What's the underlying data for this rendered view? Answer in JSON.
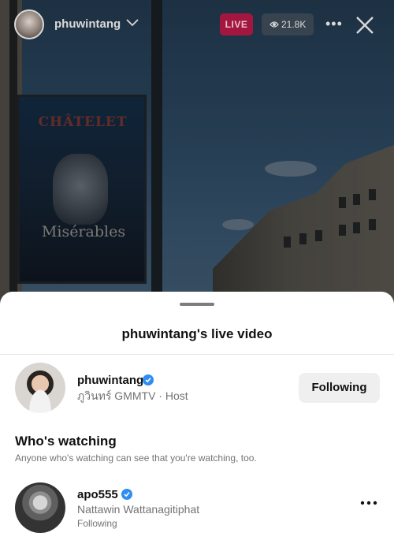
{
  "topbar": {
    "host_username": "phuwintang",
    "live_label": "LIVE",
    "viewer_count": "21.8K",
    "more_icon": "more-horizontal-icon",
    "close_icon": "close-icon"
  },
  "video": {
    "billboard_title": "CHÂTELET",
    "billboard_subtitle": "Misérables"
  },
  "sheet": {
    "title": "phuwintang's live video",
    "host": {
      "username": "phuwintang",
      "subtitle": "ภูวินทร์ GMMTV · Host",
      "verified": true,
      "follow_label": "Following"
    },
    "watching": {
      "title": "Who's watching",
      "description": "Anyone who's watching can see that you're watching, too.",
      "viewers": [
        {
          "username": "apo555",
          "full_name": "Nattawin Wattanagitiphat",
          "status": "Following",
          "verified": true
        }
      ]
    }
  },
  "colors": {
    "live_badge": "#a3163f",
    "verified_badge": "#2f8df3",
    "follow_button_bg": "#efefef"
  }
}
